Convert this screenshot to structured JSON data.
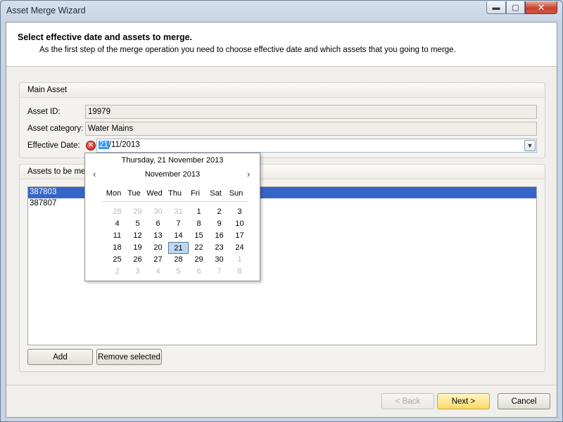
{
  "window": {
    "title": "Asset Merge Wizard",
    "controls": {
      "minimize": "▬",
      "maximize": "▢",
      "close": "✕"
    }
  },
  "header": {
    "title": "Select effective date and assets to merge.",
    "subtitle": "As the first step of the merge operation you need to choose effective date and which assets that you going to merge."
  },
  "main_asset": {
    "group_title": "Main Asset",
    "asset_id_label": "Asset ID:",
    "asset_id_value": "19979",
    "category_label": "Asset category:",
    "category_value": "Water Mains",
    "effective_date_label": "Effective Date:",
    "effective_date_selected": "21",
    "effective_date_rest": "/11/2013",
    "error_icon": "error-icon"
  },
  "assets_group": {
    "title": "Assets to be mer",
    "items": [
      {
        "label": "387803",
        "selected": true
      },
      {
        "label": "387807",
        "selected": false
      }
    ],
    "add_label": "Add",
    "remove_label": "Remove selected"
  },
  "calendar": {
    "today_text": "Thursday, 21 November 2013",
    "month_text": "November 2013",
    "prev": "‹",
    "next": "›",
    "weekdays": [
      "Mon",
      "Tue",
      "Wed",
      "Thu",
      "Fri",
      "Sat",
      "Sun"
    ],
    "weeks": [
      [
        {
          "d": "28",
          "o": true
        },
        {
          "d": "29",
          "o": true
        },
        {
          "d": "30",
          "o": true
        },
        {
          "d": "31",
          "o": true
        },
        {
          "d": "1"
        },
        {
          "d": "2"
        },
        {
          "d": "3"
        }
      ],
      [
        {
          "d": "4"
        },
        {
          "d": "5"
        },
        {
          "d": "6"
        },
        {
          "d": "7"
        },
        {
          "d": "8"
        },
        {
          "d": "9"
        },
        {
          "d": "10"
        }
      ],
      [
        {
          "d": "11"
        },
        {
          "d": "12"
        },
        {
          "d": "13"
        },
        {
          "d": "14"
        },
        {
          "d": "15"
        },
        {
          "d": "16"
        },
        {
          "d": "17"
        }
      ],
      [
        {
          "d": "18"
        },
        {
          "d": "19"
        },
        {
          "d": "20"
        },
        {
          "d": "21",
          "s": true
        },
        {
          "d": "22"
        },
        {
          "d": "23"
        },
        {
          "d": "24"
        }
      ],
      [
        {
          "d": "25"
        },
        {
          "d": "26"
        },
        {
          "d": "27"
        },
        {
          "d": "28"
        },
        {
          "d": "29"
        },
        {
          "d": "30"
        },
        {
          "d": "1",
          "o": true
        }
      ],
      [
        {
          "d": "2",
          "o": true
        },
        {
          "d": "3",
          "o": true
        },
        {
          "d": "4",
          "o": true
        },
        {
          "d": "5",
          "o": true
        },
        {
          "d": "6",
          "o": true
        },
        {
          "d": "7",
          "o": true
        },
        {
          "d": "8",
          "o": true
        }
      ]
    ]
  },
  "footer": {
    "back_label": "< Back",
    "next_label": "Next >",
    "cancel_label": "Cancel"
  }
}
